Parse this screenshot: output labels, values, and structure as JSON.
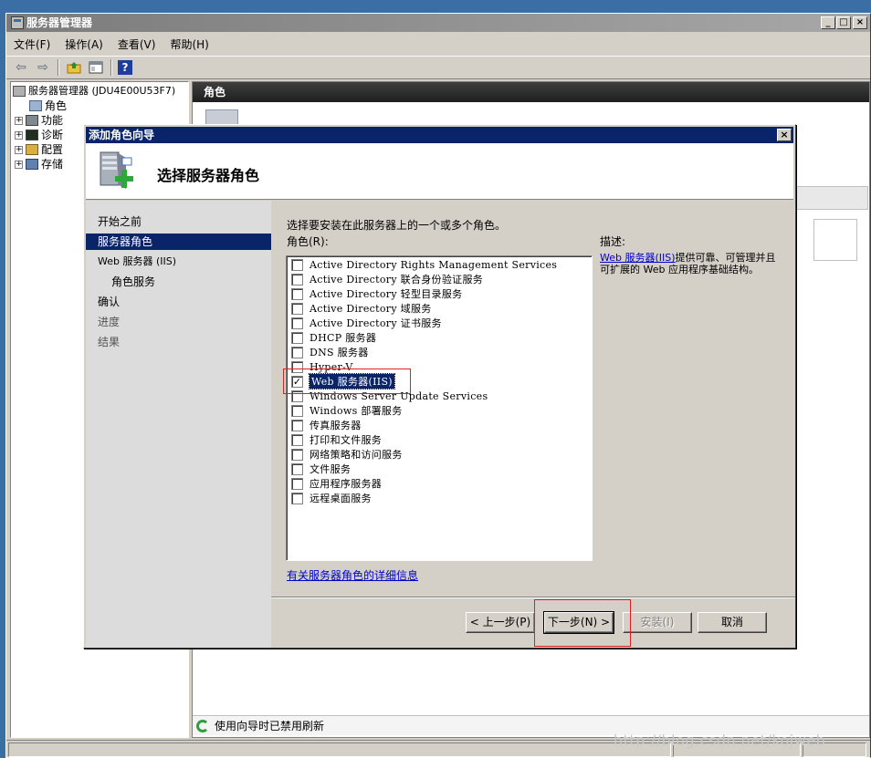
{
  "main_window": {
    "title": "服务器管理器",
    "min_btn": "_",
    "max_btn": "□",
    "close_btn": "×"
  },
  "menu": [
    "文件(F)",
    "操作(A)",
    "查看(V)",
    "帮助(H)"
  ],
  "toolbar": {
    "back_icon": "back-arrow-icon",
    "forward_icon": "forward-arrow-icon",
    "help_label": "?"
  },
  "tree": {
    "root": "服务器管理器 (JDU4E00U53F7)",
    "items": [
      "角色",
      "功能",
      "诊断",
      "配置",
      "存储"
    ]
  },
  "right_pane": {
    "header": "角色",
    "status_text": "使用向导时已禁用刷新"
  },
  "dialog": {
    "title": "添加角色向导",
    "close_btn": "×",
    "header_title": "选择服务器角色",
    "nav": [
      {
        "label": "开始之前",
        "state": "normal"
      },
      {
        "label": "服务器角色",
        "state": "active"
      },
      {
        "label": "Web 服务器 (IIS)",
        "state": "normal"
      },
      {
        "label": "角色服务",
        "state": "sub"
      },
      {
        "label": "确认",
        "state": "normal"
      },
      {
        "label": "进度",
        "state": "disabled"
      },
      {
        "label": "结果",
        "state": "disabled"
      }
    ],
    "instruction": "选择要安装在此服务器上的一个或多个角色。",
    "roles_label": "角色(R):",
    "roles": [
      {
        "label": "Active Directory Rights Management Services",
        "checked": false
      },
      {
        "label": "Active Directory 联合身份验证服务",
        "checked": false
      },
      {
        "label": "Active Directory 轻型目录服务",
        "checked": false
      },
      {
        "label": "Active Directory 域服务",
        "checked": false
      },
      {
        "label": "Active Directory 证书服务",
        "checked": false
      },
      {
        "label": "DHCP 服务器",
        "checked": false
      },
      {
        "label": "DNS 服务器",
        "checked": false
      },
      {
        "label": "Hyper-V",
        "checked": false
      },
      {
        "label": "Web 服务器(IIS)",
        "checked": true
      },
      {
        "label": "Windows Server Update Services",
        "checked": false
      },
      {
        "label": "Windows 部署服务",
        "checked": false
      },
      {
        "label": "传真服务器",
        "checked": false
      },
      {
        "label": "打印和文件服务",
        "checked": false
      },
      {
        "label": "网络策略和访问服务",
        "checked": false
      },
      {
        "label": "文件服务",
        "checked": false
      },
      {
        "label": "应用程序服务器",
        "checked": false
      },
      {
        "label": "远程桌面服务",
        "checked": false
      }
    ],
    "checkmark": "✓",
    "more_info_link": "有关服务器角色的详细信息",
    "desc_label": "描述:",
    "desc_link": "Web 服务器(IIS)",
    "desc_text": "提供可靠、可管理并且可扩展的 Web 应用程序基础结构。",
    "buttons": {
      "back": "< 上一步(P)",
      "next": "下一步(N) >",
      "install": "安装(I)",
      "cancel": "取消"
    }
  },
  "watermark": "http://blog.csdn.net/kojweb"
}
